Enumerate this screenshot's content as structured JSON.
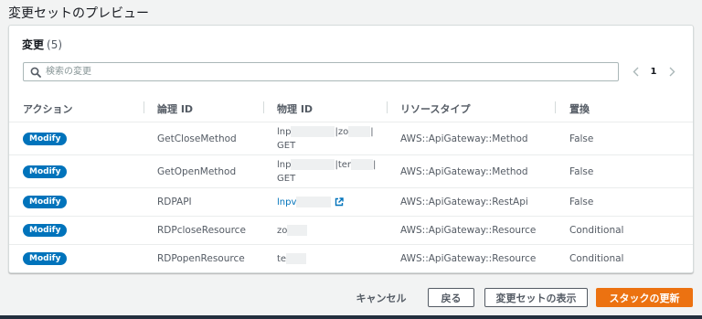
{
  "page": {
    "title": "変更セットのプレビュー"
  },
  "panel": {
    "title": "変更",
    "count": "(5)",
    "search_placeholder": "検索の変更",
    "pagination": {
      "current_page": "1"
    },
    "columns": [
      "アクション",
      "論理 ID",
      "物理 ID",
      "リソースタイプ",
      "置換"
    ],
    "rows": [
      {
        "action": "Modify",
        "logical_id": "GetCloseMethod",
        "physical_line1_a": "lnp",
        "physical_line1_b": "|zo",
        "physical_line1_c": "|",
        "physical_line2": "GET",
        "resource_type": "AWS::ApiGateway::Method",
        "replacement": "False"
      },
      {
        "action": "Modify",
        "logical_id": "GetOpenMethod",
        "physical_line1_a": "lnp",
        "physical_line1_b": "|ter",
        "physical_line1_c": "|",
        "physical_line2": "GET",
        "resource_type": "AWS::ApiGateway::Method",
        "replacement": "False"
      },
      {
        "action": "Modify",
        "logical_id": "RDPAPI",
        "physical_link": "lnpv",
        "resource_type": "AWS::ApiGateway::RestApi",
        "replacement": "False"
      },
      {
        "action": "Modify",
        "logical_id": "RDPcloseResource",
        "physical": "zo",
        "resource_type": "AWS::ApiGateway::Resource",
        "replacement": "Conditional"
      },
      {
        "action": "Modify",
        "logical_id": "RDPopenResource",
        "physical": "te",
        "resource_type": "AWS::ApiGateway::Resource",
        "replacement": "Conditional"
      }
    ]
  },
  "footer": {
    "cancel_label": "キャンセル",
    "back_label": "戻る",
    "view_changeset_label": "変更セットの表示",
    "execute_label": "スタックの更新"
  },
  "colors": {
    "accent": "#0073bb",
    "primary_button": "#ec7211",
    "background": "#f2f3f3"
  }
}
